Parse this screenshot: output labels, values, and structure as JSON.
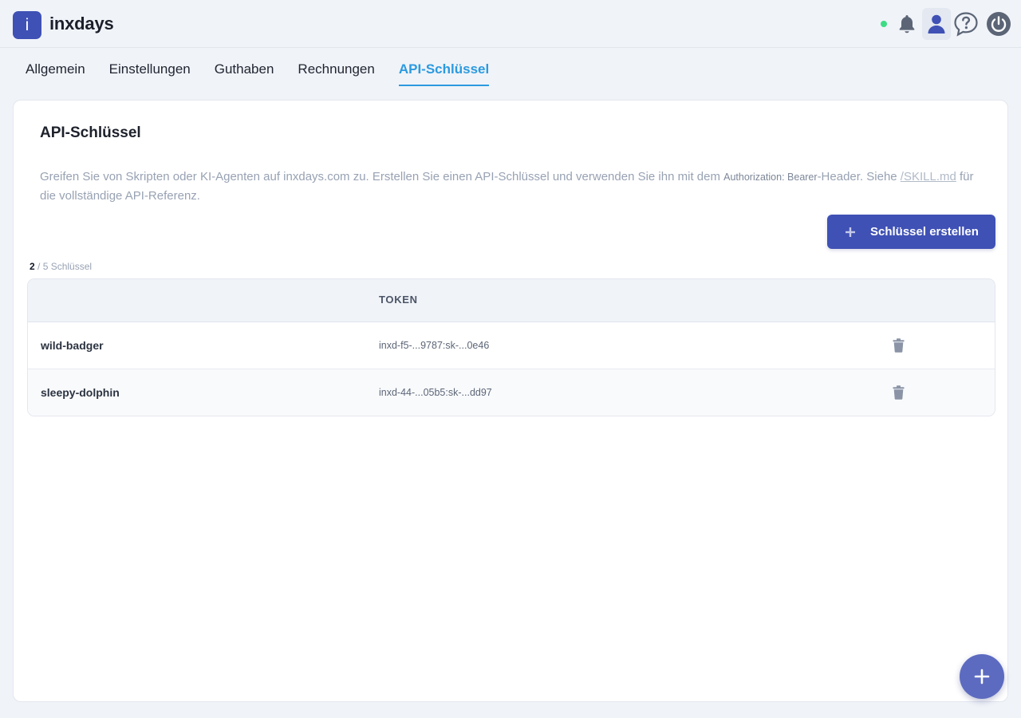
{
  "app": {
    "logo_letter": "i",
    "name": "inxdays"
  },
  "header": {
    "status_color": "#3ddc84",
    "icons": [
      "bell-icon",
      "user-icon",
      "help-icon",
      "power-icon"
    ]
  },
  "tabs": [
    {
      "label": "Allgemein",
      "active": false
    },
    {
      "label": "Einstellungen",
      "active": false
    },
    {
      "label": "Guthaben",
      "active": false
    },
    {
      "label": "Rechnungen",
      "active": false
    },
    {
      "label": "API-Schlüssel",
      "active": true
    }
  ],
  "card": {
    "title": "API-Schlüssel",
    "description": {
      "part1": "Greifen Sie von Skripten oder KI-Agenten auf inxdays.com zu. Erstellen Sie einen API-Schlüssel und verwenden Sie ihn mit dem ",
      "code": "Authorization: Bearer",
      "part2": "-Header. Siehe ",
      "link": "/SKILL.md",
      "part3": " für die vollständige API-Referenz."
    },
    "create_button_label": "Schlüssel erstellen",
    "count_current": "2",
    "count_rest": " / 5 Schlüssel"
  },
  "table": {
    "columns": [
      "",
      "TOKEN",
      ""
    ],
    "rows": [
      {
        "name": "wild-badger",
        "token": "inxd-f5-...9787:sk-...0e46"
      },
      {
        "name": "sleepy-dolphin",
        "token": "inxd-44-...05b5:sk-...dd97"
      }
    ]
  },
  "colors": {
    "primary": "#3f51b5",
    "accent_tab": "#2b9ae0",
    "fab": "#5c6bc0",
    "background": "#f0f3f8"
  }
}
